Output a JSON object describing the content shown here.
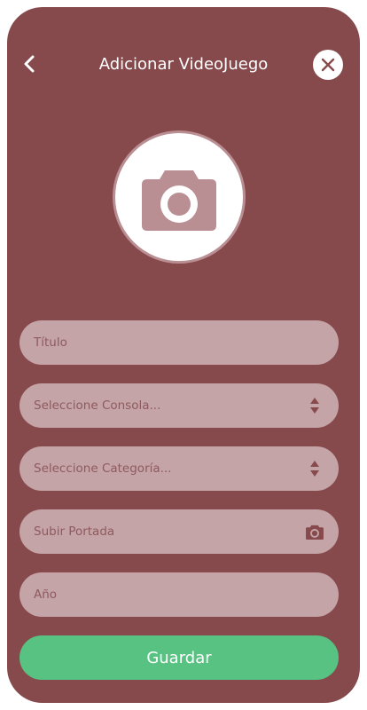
{
  "header": {
    "title": "Adicionar VideoJuego",
    "back_icon": "chevron-left-icon",
    "close_icon": "close-icon"
  },
  "cover_preview": {
    "icon": "camera-icon"
  },
  "form": {
    "title_placeholder": "Título",
    "console_placeholder": "Seleccione Consola...",
    "category_placeholder": "Seleccione Categoría...",
    "cover_placeholder": "Subir Portada",
    "year_placeholder": "Año",
    "save_label": "Guardar"
  },
  "colors": {
    "background": "#874a4c",
    "field": "#c5a4a8",
    "field_text": "#8d5a5e",
    "accent": "#58c283"
  }
}
